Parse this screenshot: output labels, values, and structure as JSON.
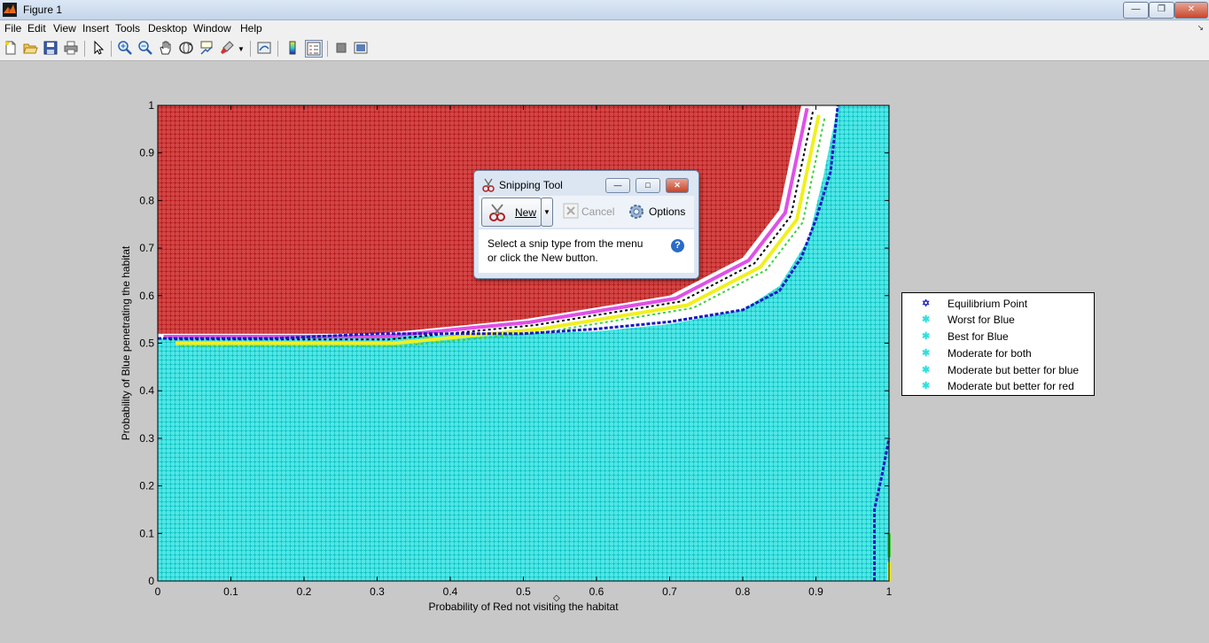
{
  "window": {
    "title": "Figure 1",
    "controls": [
      "minimize",
      "maximize",
      "close"
    ]
  },
  "menu": {
    "items": [
      "File",
      "Edit",
      "View",
      "Insert",
      "Tools",
      "Desktop",
      "Window",
      "Help"
    ]
  },
  "toolbar": {
    "icons": [
      "new-figure-icon",
      "open-file-icon",
      "save-icon",
      "print-icon",
      "edit-plot-icon",
      "zoom-in-icon",
      "zoom-out-icon",
      "pan-icon",
      "rotate-3d-icon",
      "data-cursor-icon",
      "brush-icon",
      "link-plot-icon",
      "colorbar-icon",
      "legend-icon",
      "hide-plot-tools-icon",
      "show-plot-tools-icon"
    ]
  },
  "colors": {
    "red_region": "#cc3333",
    "cyan_region": "#33dede",
    "magenta": "#e050e8",
    "yellow": "#f0f020",
    "green": "#40d040",
    "blue_eq": "#1a1ac0",
    "black": "#000000"
  },
  "chart_data": {
    "type": "scatter",
    "xlabel": "Probability of Red not visiting the habitat",
    "ylabel": "Probability of Blue penetrating the habitat",
    "xlim": [
      0,
      1
    ],
    "ylim": [
      0,
      1
    ],
    "xticks": [
      "0",
      "0.1",
      "0.2",
      "0.3",
      "0.4",
      "0.5",
      "0.6",
      "0.7",
      "0.8",
      "0.9",
      "1"
    ],
    "yticks": [
      "0",
      "0.1",
      "0.2",
      "0.3",
      "0.4",
      "0.5",
      "0.6",
      "0.7",
      "0.8",
      "0.9",
      "1"
    ],
    "grid": false,
    "legend_position": "right-outside",
    "legend": [
      {
        "label": "Equilibrium Point",
        "color": "#1a1ac0",
        "marker": "hexagram"
      },
      {
        "label": "Worst for Blue",
        "color": "#33dede",
        "marker": "*"
      },
      {
        "label": "Best for Blue",
        "color": "#33dede",
        "marker": "*"
      },
      {
        "label": "Moderate for both",
        "color": "#33dede",
        "marker": "*"
      },
      {
        "label": "Moderate but better for blue",
        "color": "#33dede",
        "marker": "*"
      },
      {
        "label": "Moderate but better for red",
        "color": "#33dede",
        "marker": "*"
      }
    ],
    "regions": [
      {
        "name": "red region (upper-left)",
        "color": "#cc3333",
        "boundary_curve": [
          [
            0,
            0.52
          ],
          [
            0.3,
            0.52
          ],
          [
            0.5,
            0.55
          ],
          [
            0.7,
            0.6
          ],
          [
            0.8,
            0.68
          ],
          [
            0.85,
            0.78
          ],
          [
            0.88,
            1.0
          ]
        ]
      },
      {
        "name": "cyan region (lower and right)",
        "color": "#33dede",
        "boundary_curve": [
          [
            0,
            0.51
          ],
          [
            0.3,
            0.515
          ],
          [
            0.5,
            0.52
          ],
          [
            0.6,
            0.525
          ],
          [
            0.7,
            0.54
          ],
          [
            0.8,
            0.57
          ],
          [
            0.85,
            0.62
          ],
          [
            0.89,
            0.72
          ],
          [
            0.91,
            0.85
          ],
          [
            0.93,
            1.0
          ]
        ]
      }
    ],
    "equilibrium_curve": [
      [
        0,
        0.51
      ],
      [
        0.16,
        0.51
      ],
      [
        0.3,
        0.52
      ],
      [
        0.5,
        0.52
      ],
      [
        0.6,
        0.53
      ],
      [
        0.7,
        0.545
      ],
      [
        0.8,
        0.57
      ],
      [
        0.85,
        0.61
      ],
      [
        0.88,
        0.68
      ],
      [
        0.9,
        0.76
      ],
      [
        0.92,
        0.86
      ],
      [
        0.93,
        1.0
      ]
    ],
    "equilibrium_right_edge": [
      [
        0.98,
        0.0
      ],
      [
        0.98,
        0.15
      ],
      [
        0.99,
        0.22
      ],
      [
        1.0,
        0.3
      ]
    ]
  },
  "snipping_tool": {
    "title": "Snipping Tool",
    "new_label": "New",
    "cancel_label": "Cancel",
    "options_label": "Options",
    "message_line1": "Select a snip type from the menu",
    "message_line2": "or click the New button.",
    "help_glyph": "?"
  },
  "cursor_glyph": "◇"
}
